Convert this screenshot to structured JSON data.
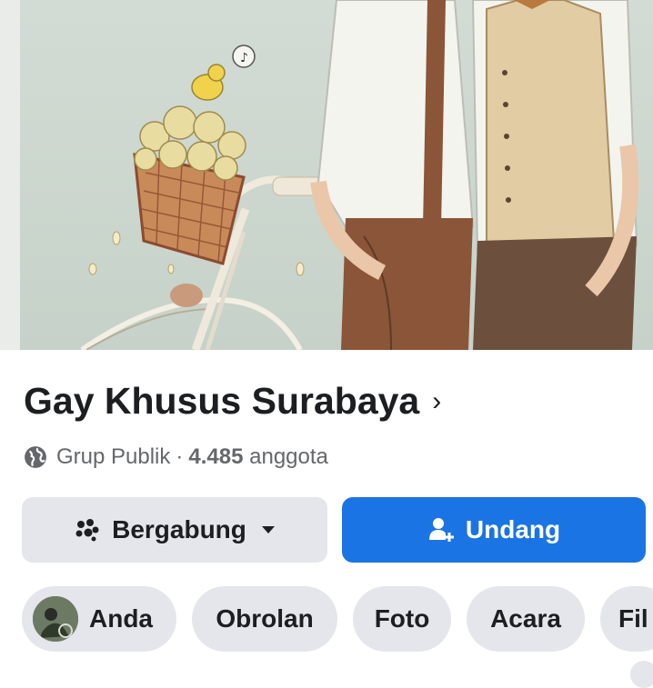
{
  "cover": {
    "description_icon": "cover-photo"
  },
  "group": {
    "name": "Gay Khusus Surabaya",
    "chevron": "›",
    "privacy": "Grup Publik",
    "separator": "·",
    "member_count": "4.485",
    "member_label": "anggota"
  },
  "actions": {
    "join_label": "Bergabung",
    "join_icon": "group-icon",
    "dropdown_icon": "caret-down-icon",
    "invite_label": "Undang",
    "invite_icon": "add-person-icon"
  },
  "tabs": [
    {
      "label": "Anda"
    },
    {
      "label": "Obrolan"
    },
    {
      "label": "Foto"
    },
    {
      "label": "Acara"
    },
    {
      "label": "Fil"
    }
  ],
  "colors": {
    "primary": "#1b74e4",
    "secondary_bg": "#e4e6eb",
    "text": "#1c1e21",
    "muted": "#65676b"
  }
}
